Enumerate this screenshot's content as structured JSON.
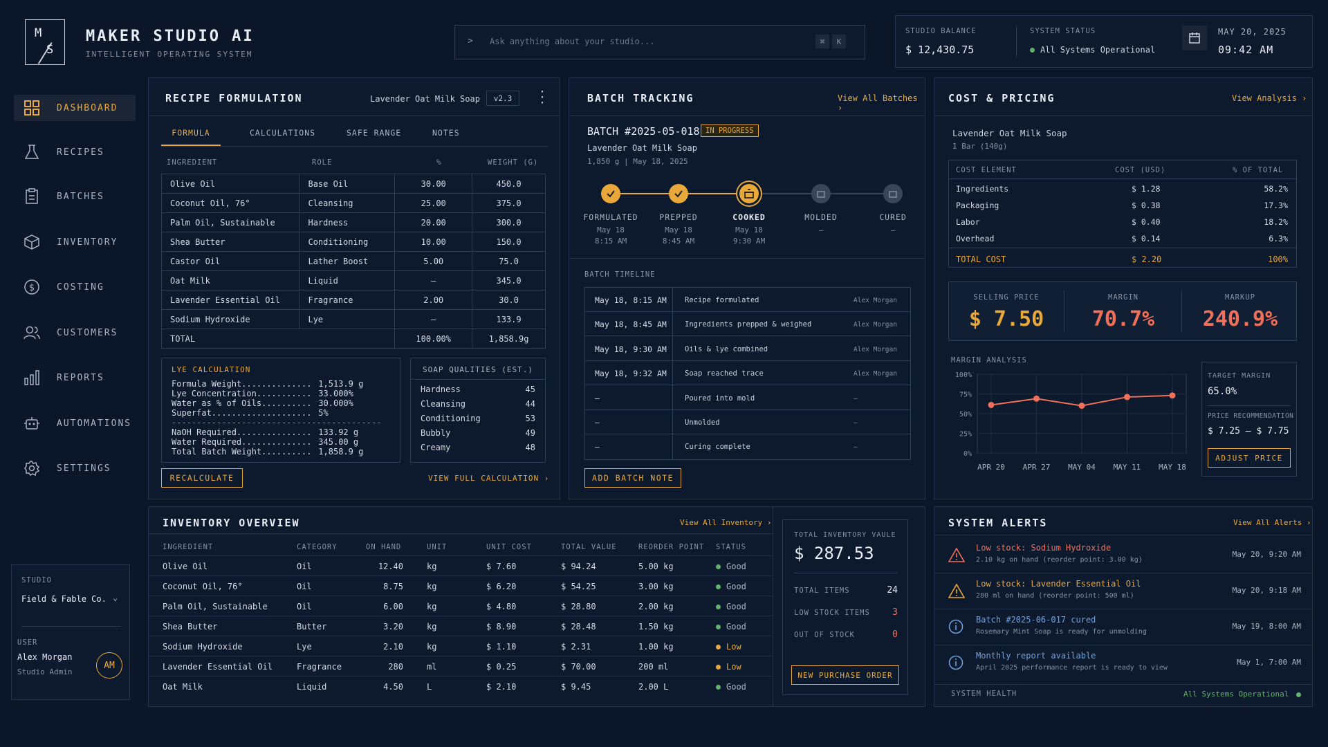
{
  "header": {
    "logo_m": "M",
    "logo_s": "S",
    "app_title": "MAKER STUDIO AI",
    "app_subtitle": "INTELLIGENT OPERATING SYSTEM",
    "search_placeholder": "Ask anything about your studio...",
    "search_prompt_glyph": ">",
    "kbd_cmd": "⌘",
    "kbd_k": "K",
    "studio_balance_label": "STUDIO BALANCE",
    "studio_balance_value": "$ 12,430.75",
    "system_status_label": "SYSTEM STATUS",
    "system_status_value": "All Systems Operational",
    "date": "MAY 20, 2025",
    "time": "09:42 AM"
  },
  "sidebar": {
    "items": [
      {
        "label": "DASHBOARD",
        "icon": "grid-icon"
      },
      {
        "label": "RECIPES",
        "icon": "flask-icon"
      },
      {
        "label": "BATCHES",
        "icon": "clipboard-icon"
      },
      {
        "label": "INVENTORY",
        "icon": "box-icon"
      },
      {
        "label": "COSTING",
        "icon": "dollar-icon"
      },
      {
        "label": "CUSTOMERS",
        "icon": "users-icon"
      },
      {
        "label": "REPORTS",
        "icon": "bar-chart-icon"
      },
      {
        "label": "AUTOMATIONS",
        "icon": "robot-icon"
      },
      {
        "label": "SETTINGS",
        "icon": "gear-icon"
      }
    ],
    "studio_label": "STUDIO",
    "studio_name": "Field & Fable Co.",
    "user_label": "USER",
    "user_name": "Alex Morgan",
    "user_role": "Studio Admin",
    "user_initials": "AM"
  },
  "recipe": {
    "title": "RECIPE FORMULATION",
    "product": "Lavender Oat Milk Soap",
    "version": "v2.3",
    "tabs": [
      "FORMULA",
      "CALCULATIONS",
      "SAFE RANGE",
      "NOTES"
    ],
    "columns": [
      "INGREDIENT",
      "ROLE",
      "%",
      "WEIGHT (G)"
    ],
    "rows": [
      [
        "Olive Oil",
        "Base Oil",
        "30.00",
        "450.0"
      ],
      [
        "Coconut Oil, 76°",
        "Cleansing",
        "25.00",
        "375.0"
      ],
      [
        "Palm Oil, Sustainable",
        "Hardness",
        "20.00",
        "300.0"
      ],
      [
        "Shea Butter",
        "Conditioning",
        "10.00",
        "150.0"
      ],
      [
        "Castor Oil",
        "Lather Boost",
        "5.00",
        "75.0"
      ],
      [
        "Oat Milk",
        "Liquid",
        "—",
        "345.0"
      ],
      [
        "Lavender Essential Oil",
        "Fragrance",
        "2.00",
        "30.0"
      ],
      [
        "Sodium Hydroxide",
        "Lye",
        "—",
        "133.9"
      ]
    ],
    "total_label": "TOTAL",
    "total_pct": "100.00%",
    "total_weight": "1,858.9g",
    "lye_title": "LYE CALCULATION",
    "lye_lines": [
      [
        "Formula Weight..............",
        "1,513.9 g"
      ],
      [
        "Lye Concentration...........",
        "33.000%"
      ],
      [
        "Water as % of Oils..........",
        "30.000%"
      ],
      [
        "Superfat....................",
        "5%"
      ],
      [
        "NaOH Required...............",
        "133.92 g"
      ],
      [
        "Water Required..............",
        "345.00 g"
      ],
      [
        "Total Batch Weight..........",
        "1,858.9 g"
      ]
    ],
    "lye_divider": "------------------------------------------",
    "soap_title": "SOAP QUALITIES (EST.)",
    "soap_qualities": [
      [
        "Hardness",
        "45"
      ],
      [
        "Cleansing",
        "44"
      ],
      [
        "Conditioning",
        "53"
      ],
      [
        "Bubbly",
        "49"
      ],
      [
        "Creamy",
        "48"
      ]
    ],
    "recalculate": "RECALCULATE",
    "view_full": "VIEW FULL CALCULATION"
  },
  "batch": {
    "title": "BATCH TRACKING",
    "view_all": "View All Batches",
    "batch_id": "BATCH #2025-05-018",
    "status": "IN PROGRESS",
    "product": "Lavender Oat Milk Soap",
    "meta": "1,850 g  |  May 18, 2025",
    "steps": [
      {
        "label": "FORMULATED",
        "date": "May 18",
        "time": "8:15 AM",
        "state": "done"
      },
      {
        "label": "PREPPED",
        "date": "May 18",
        "time": "8:45 AM",
        "state": "done"
      },
      {
        "label": "COOKED",
        "date": "May 18",
        "time": "9:30 AM",
        "state": "current"
      },
      {
        "label": "MOLDED",
        "date": "—",
        "time": "",
        "state": "pending"
      },
      {
        "label": "CURED",
        "date": "—",
        "time": "",
        "state": "pending"
      }
    ],
    "timeline_title": "BATCH TIMELINE",
    "timeline": [
      [
        "May 18, 8:15 AM",
        "Recipe formulated",
        "Alex Morgan"
      ],
      [
        "May 18, 8:45 AM",
        "Ingredients prepped & weighed",
        "Alex Morgan"
      ],
      [
        "May 18, 9:30 AM",
        "Oils & lye combined",
        "Alex Morgan"
      ],
      [
        "May 18, 9:32 AM",
        "Soap reached trace",
        "Alex Morgan"
      ],
      [
        "—",
        "Poured into mold",
        "—"
      ],
      [
        "—",
        "Unmolded",
        "—"
      ],
      [
        "—",
        "Curing complete",
        "—"
      ]
    ],
    "add_note": "ADD BATCH NOTE"
  },
  "cost": {
    "title": "COST & PRICING",
    "view_analysis": "View Analysis",
    "product": "Lavender Oat Milk Soap",
    "unit": "1 Bar (140g)",
    "columns": [
      "COST ELEMENT",
      "COST (USD)",
      "% OF TOTAL"
    ],
    "rows": [
      [
        "Ingredients",
        "$ 1.28",
        "58.2%"
      ],
      [
        "Packaging",
        "$ 0.38",
        "17.3%"
      ],
      [
        "Labor",
        "$ 0.40",
        "18.2%"
      ],
      [
        "Overhead",
        "$ 0.14",
        "6.3%"
      ]
    ],
    "total_label": "TOTAL COST",
    "total_cost": "$ 2.20",
    "total_pct": "100%",
    "selling_price_label": "SELLING PRICE",
    "selling_price": "$ 7.50",
    "margin_label": "MARGIN",
    "margin": "70.7%",
    "markup_label": "MARKUP",
    "markup": "240.9%",
    "margin_analysis_label": "MARGIN ANALYSIS",
    "target_margin_label": "TARGET MARGIN",
    "target_margin": "65.0%",
    "price_rec_label": "PRICE RECOMMENDATION",
    "price_rec": "$ 7.25 – $ 7.75",
    "adjust_price": "ADJUST PRICE"
  },
  "chart_data": {
    "type": "line",
    "x": [
      "APR 20",
      "APR 27",
      "MAY 04",
      "MAY 11",
      "MAY 18"
    ],
    "yticks": [
      "100%",
      "75%",
      "50%",
      "25%",
      "0%"
    ],
    "ylim": [
      0,
      100
    ],
    "series": [
      {
        "values": [
          61,
          69,
          60,
          71,
          73
        ]
      }
    ],
    "color": "#f0705a"
  },
  "inventory": {
    "title": "INVENTORY OVERVIEW",
    "view_all": "View All Inventory",
    "columns": [
      "INGREDIENT",
      "CATEGORY",
      "ON HAND",
      "UNIT",
      "UNIT COST",
      "TOTAL VALUE",
      "REORDER POINT",
      "STATUS"
    ],
    "rows": [
      [
        "Olive Oil",
        "Oil",
        "12.40",
        "kg",
        "$ 7.60",
        "$ 94.24",
        "5.00 kg",
        "Good"
      ],
      [
        "Coconut Oil, 76°",
        "Oil",
        "8.75",
        "kg",
        "$ 6.20",
        "$ 54.25",
        "3.00 kg",
        "Good"
      ],
      [
        "Palm Oil, Sustainable",
        "Oil",
        "6.00",
        "kg",
        "$ 4.80",
        "$ 28.80",
        "2.00 kg",
        "Good"
      ],
      [
        "Shea Butter",
        "Butter",
        "3.20",
        "kg",
        "$ 8.90",
        "$ 28.48",
        "1.50 kg",
        "Good"
      ],
      [
        "Sodium Hydroxide",
        "Lye",
        "2.10",
        "kg",
        "$ 1.10",
        "$ 2.31",
        "1.00 kg",
        "Low"
      ],
      [
        "Lavender Essential Oil",
        "Fragrance",
        "280",
        "ml",
        "$ 0.25",
        "$ 70.00",
        "200 ml",
        "Low"
      ],
      [
        "Oat Milk",
        "Liquid",
        "4.50",
        "L",
        "$ 2.10",
        "$ 9.45",
        "2.00 L",
        "Good"
      ]
    ],
    "total_value_label": "TOTAL INVENTORY VAULE",
    "total_value": "$ 287.53",
    "total_items_label": "TOTAL ITEMS",
    "total_items": "24",
    "low_stock_label": "LOW STOCK ITEMS",
    "low_stock": "3",
    "out_of_stock_label": "OUT OF STOCK",
    "out_of_stock": "0",
    "new_po": "NEW PURCHASE ORDER"
  },
  "alerts": {
    "title": "SYSTEM ALERTS",
    "view_all": "View All Alerts",
    "items": [
      {
        "icon": "warning-icon",
        "title": "Low stock: Sodium Hydroxide",
        "detail": "2.10 kg on hand (reorder point: 3.00 kg)",
        "time": "May 20, 9:20 AM",
        "kind": "danger"
      },
      {
        "icon": "warning-icon",
        "title": "Low stock: Lavender Essential Oil",
        "detail": "280 ml on hand (reorder point: 500 ml)",
        "time": "May 20, 9:18 AM",
        "kind": "warn"
      },
      {
        "icon": "info-icon",
        "title": "Batch #2025-06-017 cured",
        "detail": "Rosemary Mint Soap is ready for unmolding",
        "time": "May 19, 8:00 AM",
        "kind": "info"
      },
      {
        "icon": "info-icon",
        "title": "Monthly report available",
        "detail": "April 2025 performance report is ready to view",
        "time": "May 1, 7:00 AM",
        "kind": "info"
      }
    ],
    "system_health_label": "SYSTEM HEALTH",
    "system_health_value": "All Systems Operational"
  },
  "colors": {
    "accent": "#e9a93a",
    "danger": "#f0705a",
    "good": "#5fb36a",
    "info": "#6fa3e0"
  }
}
